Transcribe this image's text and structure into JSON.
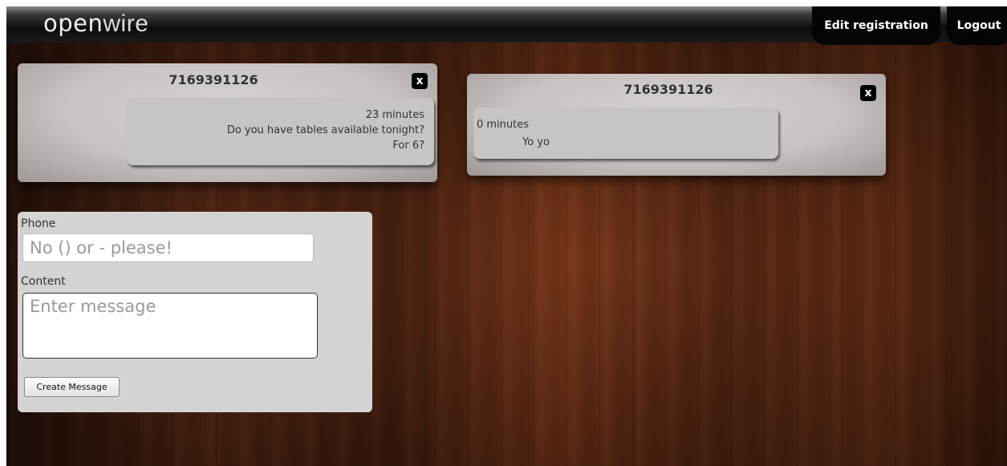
{
  "header": {
    "logo_bold": "open",
    "logo_light": "wire",
    "edit_registration": "Edit registration",
    "logout": "Logout"
  },
  "conversations": [
    {
      "phone": "7169391126",
      "close_label": "x",
      "message": {
        "time": "23 minutes",
        "line1": "Do you have tables available tonight?",
        "line2": "For 6?"
      }
    },
    {
      "phone": "7169391126",
      "close_label": "x",
      "message": {
        "time": "0 minutes",
        "line1": "Yo yo"
      }
    }
  ],
  "form": {
    "phone_label": "Phone",
    "phone_placeholder": "No () or - please!",
    "content_label": "Content",
    "content_placeholder": "Enter message",
    "submit_label": "Create Message"
  }
}
